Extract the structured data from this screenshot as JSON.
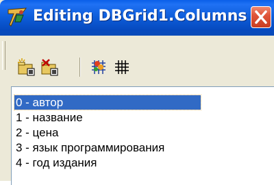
{
  "window": {
    "title": "Editing DBGrid1.Columns",
    "accent": "#0A5FE8",
    "close_color": "#E0553A"
  },
  "toolbar": {
    "buttons": [
      {
        "name": "add-new-icon"
      },
      {
        "name": "delete-selected-icon"
      },
      {
        "name": "add-all-fields-icon"
      },
      {
        "name": "restore-defaults-icon"
      }
    ]
  },
  "list": {
    "items": [
      {
        "label": "0 - автор",
        "selected": true
      },
      {
        "label": "1 - название",
        "selected": false
      },
      {
        "label": "2 - цена",
        "selected": false
      },
      {
        "label": "3 - язык программирования",
        "selected": false
      },
      {
        "label": "4 - год издания",
        "selected": false
      }
    ],
    "selection_color": "#316AC5"
  }
}
